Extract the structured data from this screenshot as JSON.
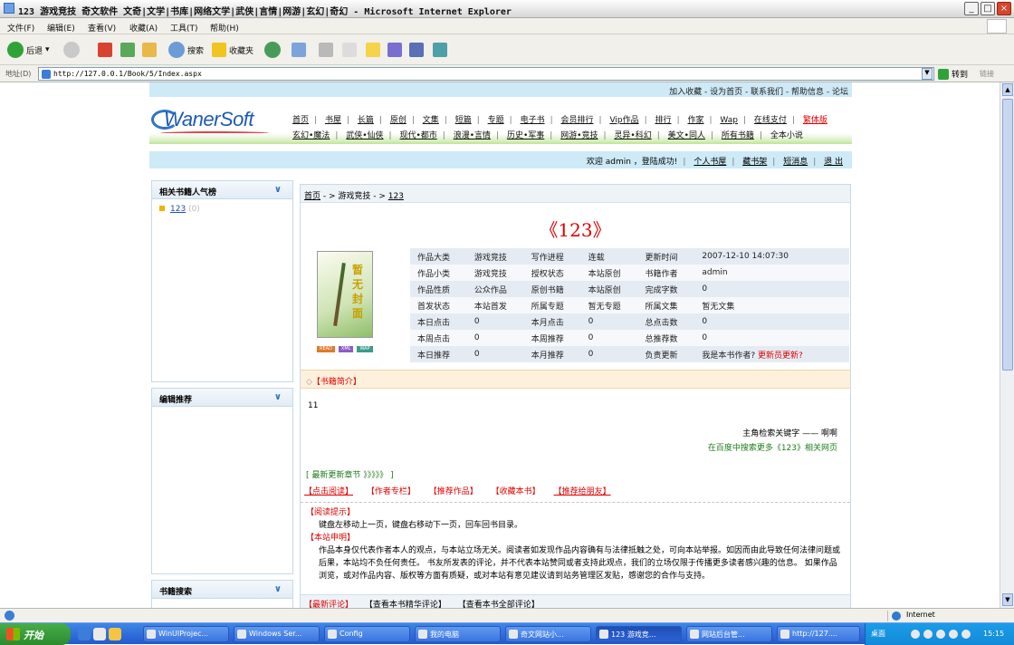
{
  "window": {
    "title": "123 游戏竞技 奇文软件 文奇|文学|书库|网络文学|武侠|言情|网游|玄幻|奇幻 - Microsoft Internet Explorer"
  },
  "menu": [
    "文件(F)",
    "编辑(E)",
    "查看(V)",
    "收藏(A)",
    "工具(T)",
    "帮助(H)"
  ],
  "toolbar": {
    "back": "后退",
    "search": "搜索",
    "favorites": "收藏夹"
  },
  "address": {
    "label": "地址(D)",
    "url": "http://127.0.0.1/Book/5/Index.aspx",
    "go": "转到",
    "links": "链接"
  },
  "site": {
    "logo": "WanerSoft",
    "toplinks": "加入收藏 - 设为首页 - 联系我们 - 帮助信息 - 论坛",
    "nav1": [
      "首页",
      "书屋",
      "长篇",
      "原创",
      "文集",
      "短篇",
      "专题",
      "电子书",
      "会员排行",
      "Vip作品",
      "排行",
      "作家",
      "Wap",
      "在线支付"
    ],
    "nav1_last": "繁体版",
    "nav2": [
      "玄幻•魔法",
      "武侠•仙侠",
      "现代•都市",
      "浪漫•言情",
      "历史•军事",
      "网游•竞技",
      "灵异•科幻",
      "美文•同人",
      "所有书籍",
      "全本小说"
    ],
    "welcome": {
      "greeting": "欢迎 admin ，登陆成功!",
      "links": [
        "个人书屋",
        "藏书架",
        "短消息",
        "退 出"
      ]
    }
  },
  "sidebar": {
    "box1": {
      "title": "相关书籍人气榜",
      "item": "123",
      "count": "(0)"
    },
    "box2": {
      "title": "编辑推荐"
    },
    "box3": {
      "title": "书籍搜索"
    }
  },
  "main": {
    "breadcrumb": {
      "home": "首页",
      "sep": " - > ",
      "category": "游戏竞技",
      "current": "123"
    },
    "book_title": "《123》",
    "cover_text": "暂无封面",
    "badges": [
      "READ",
      "XML",
      "WAP"
    ],
    "info": [
      [
        "作品大类",
        "游戏竞技",
        "写作进程",
        "连载",
        "更新时间",
        "2007-12-10 14:07:30"
      ],
      [
        "作品小类",
        "游戏竞技",
        "授权状态",
        "本站原创",
        "书籍作者",
        "admin"
      ],
      [
        "作品性质",
        "公众作品",
        "原创书籍",
        "本站原创",
        "完成字数",
        "0"
      ],
      [
        "首发状态",
        "本站首发",
        "所属专题",
        "暂无专题",
        "所属文集",
        "暂无文集"
      ],
      [
        "本日点击",
        "0",
        "本月点击",
        "0",
        "总点击数",
        "0"
      ],
      [
        "本周点击",
        "0",
        "本周推荐",
        "0",
        "总推荐数",
        "0"
      ],
      [
        "本日推荐",
        "0",
        "本月推荐",
        "0",
        "负责更新",
        "我是本书作者?"
      ]
    ],
    "update_link": "更新员更新?",
    "intro_header": "【书籍简介】",
    "intro_text": "11",
    "intro_keywords": "主角检索关键字 —— 啊啊",
    "intro_baidu": "在百度中搜索更多《123》相关网页",
    "latest": "[ 最新更新章节 》》》》》 ]",
    "actions": [
      "【点击阅读】",
      "【作者专栏】",
      "【推荐作品】",
      "【收藏本书】",
      "【推荐给朋友】"
    ],
    "notice": {
      "tip_title": "【阅读提示】",
      "tip_text": "键盘左移动上一页，键盘右移动下一页，回车回书目录。",
      "stmt_title": "【本站申明】",
      "stmt_text": "作品本身仅代表作者本人的观点，与本站立场无关。阅读者如发现作品内容确有与法律抵触之处，可向本站举报。如因而由此导致任何法律问题或后果，本站均不负任何责任。 书友所发表的评论，并不代表本站赞同或者支持此观点，我们的立场仅限于传播更多读者感兴趣的信息。 如果作品浏览，或对作品内容、版权等方面有质疑，或对本站有意见建议请到站务管理区发贴，感谢您的合作与支持。"
    },
    "comments": [
      "【最新评论】",
      "【查看本书精华评论】",
      "【查看本书全部评论】"
    ]
  },
  "statusbar": {
    "zone": "Internet"
  },
  "taskbar": {
    "start": "开始",
    "tasks": [
      "WinUIProjec...",
      "Windows Ser...",
      "Config",
      "我的电脑",
      "奇文网站小...",
      "123 游戏竞...",
      "网站后台管...",
      "http://127...."
    ],
    "desktop": "桌面",
    "clock": "15:15"
  },
  "colors": {
    "accent_red": "#e00000",
    "header_blue": "#cdeaf6",
    "taskbar": "#2458cf"
  }
}
